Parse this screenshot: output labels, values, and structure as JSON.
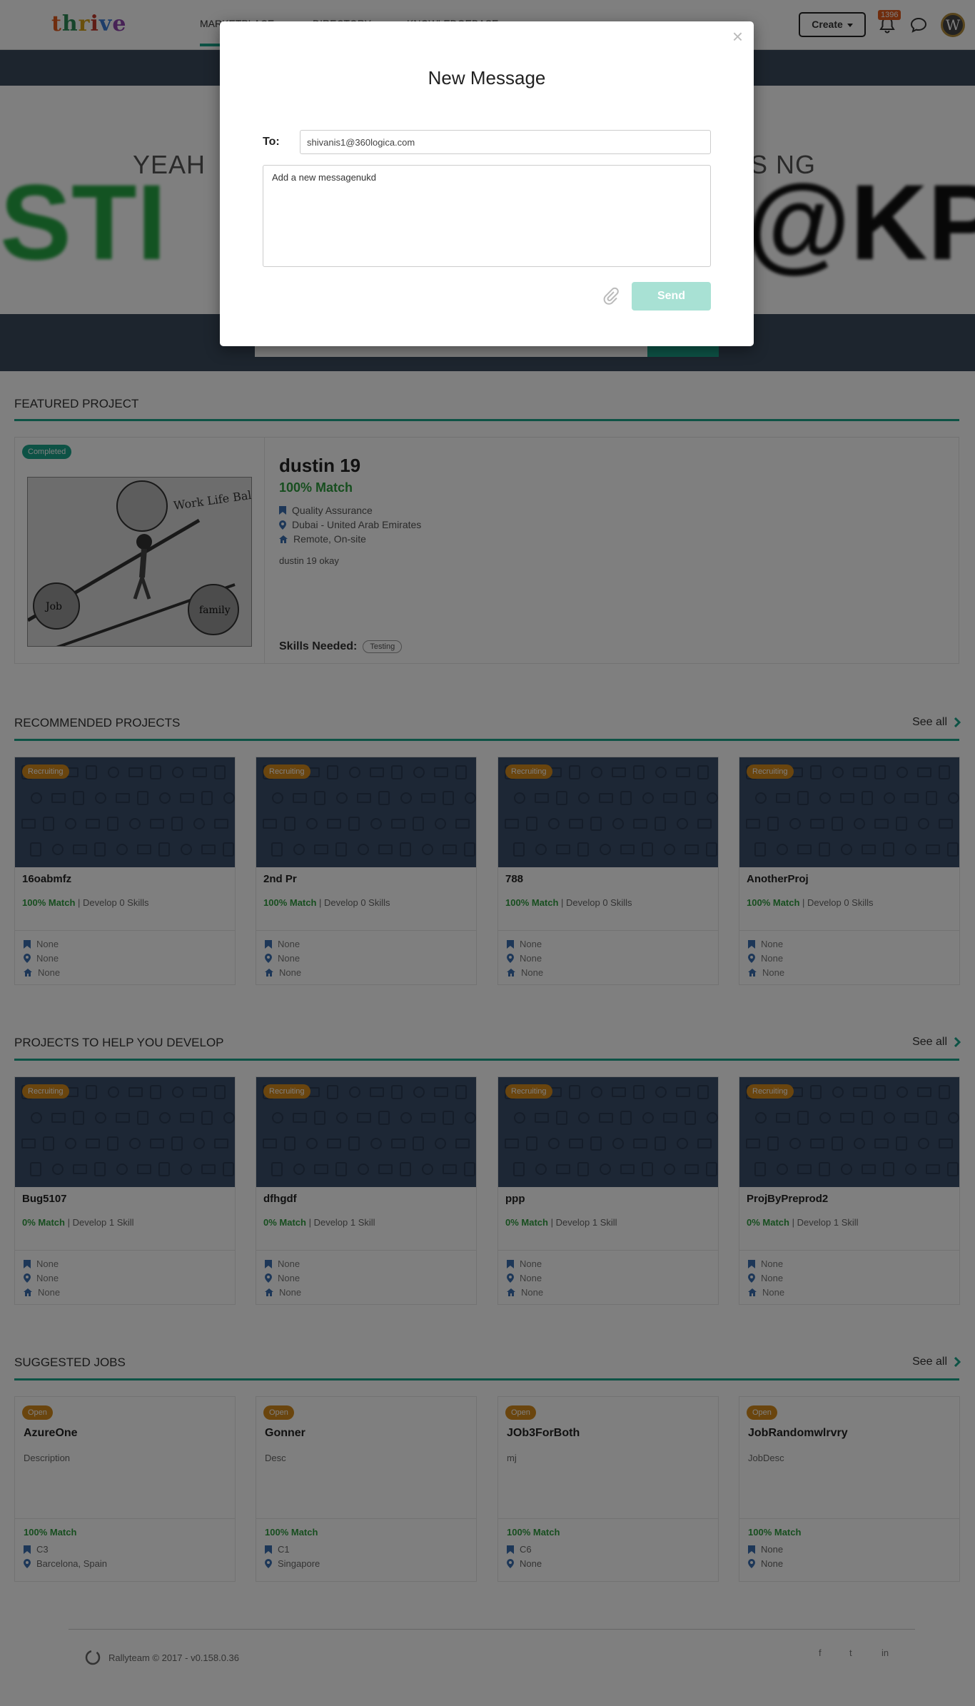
{
  "header": {
    "logo": [
      "t",
      "h",
      "r",
      "i",
      "v",
      "e"
    ],
    "nav": [
      "MARKETPLACE",
      "DIRECTORY",
      "KNOWLEDGEBASE"
    ],
    "create_label": "Create",
    "notification_count": "1396"
  },
  "hero": {
    "subtitle_left": "YEAH",
    "subtitle_right": "IS NG",
    "big_left": "STI",
    "big_right": "@KP"
  },
  "featured": {
    "section_title": "FEATURED PROJECT",
    "status": "Completed",
    "title": "dustin 19",
    "match": "100% Match",
    "category": "Quality Assurance",
    "location": "Dubai - United Arab Emirates",
    "work_mode": "Remote, On-site",
    "description": "dustin 19 okay",
    "skills_label": "Skills Needed:",
    "skill": "Testing",
    "image_text": {
      "balloon_top": "Work Life Balance",
      "left_ball": "Job",
      "right_ball": "family"
    }
  },
  "recommended": {
    "section_title": "RECOMMENDED PROJECTS",
    "see_all": "See all",
    "cards": [
      {
        "status": "Recruiting",
        "name": "16oabmfz",
        "match": "100% Match",
        "develop": " | Develop 0 Skills",
        "meta": [
          "None",
          "None",
          "None"
        ]
      },
      {
        "status": "Recruiting",
        "name": "2nd Pr",
        "match": "100% Match",
        "develop": " | Develop 0 Skills",
        "meta": [
          "None",
          "None",
          "None"
        ]
      },
      {
        "status": "Recruiting",
        "name": "788",
        "match": "100% Match",
        "develop": " | Develop 0 Skills",
        "meta": [
          "None",
          "None",
          "None"
        ]
      },
      {
        "status": "Recruiting",
        "name": "AnotherProj",
        "match": "100% Match",
        "develop": " | Develop 0 Skills",
        "meta": [
          "None",
          "None",
          "None"
        ]
      }
    ]
  },
  "develop": {
    "section_title": "PROJECTS TO HELP YOU DEVELOP",
    "see_all": "See all",
    "cards": [
      {
        "status": "Recruiting",
        "name": "Bug5107",
        "match": "0% Match",
        "develop": " | Develop 1 Skill",
        "meta": [
          "None",
          "None",
          "None"
        ]
      },
      {
        "status": "Recruiting",
        "name": "dfhgdf",
        "match": "0% Match",
        "develop": " | Develop 1 Skill",
        "meta": [
          "None",
          "None",
          "None"
        ]
      },
      {
        "status": "Recruiting",
        "name": "ppp",
        "match": "0% Match",
        "develop": " | Develop 1 Skill",
        "meta": [
          "None",
          "None",
          "None"
        ]
      },
      {
        "status": "Recruiting",
        "name": "ProjByPreprod2",
        "match": "0% Match",
        "develop": " | Develop 1 Skill",
        "meta": [
          "None",
          "None",
          "None"
        ]
      }
    ]
  },
  "jobs": {
    "section_title": "SUGGESTED JOBS",
    "see_all": "See all",
    "cards": [
      {
        "status": "Open",
        "name": "AzureOne",
        "desc": "Description",
        "match": "100% Match",
        "grade": "C3",
        "location": "Barcelona, Spain"
      },
      {
        "status": "Open",
        "name": "Gonner",
        "desc": "Desc",
        "match": "100% Match",
        "grade": "C1",
        "location": "Singapore"
      },
      {
        "status": "Open",
        "name": "JOb3ForBoth",
        "desc": "mj",
        "match": "100% Match",
        "grade": "C6",
        "location": "None"
      },
      {
        "status": "Open",
        "name": "JobRandomwlrvry",
        "desc": "JobDesc",
        "match": "100% Match",
        "grade": "None",
        "location": "None"
      }
    ]
  },
  "footer": {
    "copyright": "Rallyteam © 2017 - v0.158.0.36",
    "social": [
      "f",
      "t",
      "in"
    ]
  },
  "modal": {
    "title": "New Message",
    "close": "×",
    "to_label": "To:",
    "to_value": "shivanis1@360logica.com",
    "message_value": "Add a new messagenukd",
    "send_label": "Send"
  },
  "colors": {
    "accent": "#1aa58a",
    "match_green": "#2e9c3e",
    "recruiting_orange": "#d48a1c",
    "card_pattern": "#3b4e6a",
    "send_disabled": "#a8e1d4"
  }
}
